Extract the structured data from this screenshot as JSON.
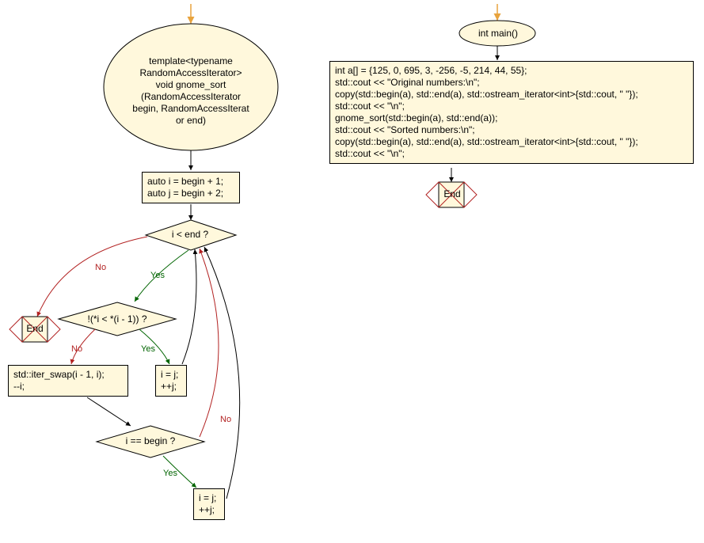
{
  "chart_data": {
    "type": "flowchart",
    "functions": [
      {
        "name": "gnome_sort",
        "signature": "template<typename RandomAccessIterator> void gnome_sort (RandomAccessIterator begin, RandomAccessIterat or end)",
        "nodes": [
          {
            "id": "start1",
            "kind": "start",
            "label": "template<typename RandomAccessIterator> void gnome_sort (RandomAccessIterator begin, RandomAccessIterat or end)"
          },
          {
            "id": "init1",
            "kind": "process",
            "label": "auto i = begin + 1;\nauto j = begin + 2;"
          },
          {
            "id": "cond_outer",
            "kind": "decision",
            "label": "i < end ?"
          },
          {
            "id": "end1",
            "kind": "end",
            "label": "End"
          },
          {
            "id": "cond_inner",
            "kind": "decision",
            "label": "!(*i < *(i - 1)) ?"
          },
          {
            "id": "swap",
            "kind": "process",
            "label": "std::iter_swap(i - 1, i);\n--i;"
          },
          {
            "id": "advance1",
            "kind": "process",
            "label": "i = j;\n++j;"
          },
          {
            "id": "cond_begin",
            "kind": "decision",
            "label": "i == begin ?"
          },
          {
            "id": "advance2",
            "kind": "process",
            "label": "i = j;\n++j;"
          }
        ],
        "edges": [
          {
            "from": "start1",
            "to": "init1"
          },
          {
            "from": "init1",
            "to": "cond_outer"
          },
          {
            "from": "cond_outer",
            "to": "end1",
            "label": "No"
          },
          {
            "from": "cond_outer",
            "to": "cond_inner",
            "label": "Yes"
          },
          {
            "from": "cond_inner",
            "to": "swap",
            "label": "No"
          },
          {
            "from": "cond_inner",
            "to": "advance1",
            "label": "Yes"
          },
          {
            "from": "advance1",
            "to": "cond_outer"
          },
          {
            "from": "swap",
            "to": "cond_begin"
          },
          {
            "from": "cond_begin",
            "to": "cond_outer",
            "label": "No"
          },
          {
            "from": "cond_begin",
            "to": "advance2",
            "label": "Yes"
          },
          {
            "from": "advance2",
            "to": "cond_outer"
          }
        ]
      },
      {
        "name": "main",
        "signature": "int main()",
        "nodes": [
          {
            "id": "start2",
            "kind": "start",
            "label": "int main()"
          },
          {
            "id": "body2",
            "kind": "process",
            "label": "int a[] = {125, 0, 695, 3, -256, -5, 214, 44, 55};\nstd::cout << \"Original numbers:\\n\";\ncopy(std::begin(a), std::end(a), std::ostream_iterator<int>{std::cout, \" \"});\nstd::cout << \"\\n\";\ngnome_sort(std::begin(a), std::end(a));\nstd::cout << \"Sorted numbers:\\n\";\ncopy(std::begin(a), std::end(a), std::ostream_iterator<int>{std::cout, \" \"});\nstd::cout << \"\\n\";"
          },
          {
            "id": "end2",
            "kind": "end",
            "label": "End"
          }
        ],
        "edges": [
          {
            "from": "start2",
            "to": "body2"
          },
          {
            "from": "body2",
            "to": "end2"
          }
        ]
      }
    ]
  },
  "labels": {
    "start1": "template<typename\nRandomAccessIterator>\nvoid gnome_sort\n(RandomAccessIterator\nbegin, RandomAccessIterat\nor end)",
    "init_line1": "auto i = begin + 1;",
    "init_line2": "auto j = begin + 2;",
    "cond_outer": "i < end ?",
    "end1": "End",
    "cond_inner": "!(*i < *(i - 1)) ?",
    "swap_line1": "std::iter_swap(i - 1, i);",
    "swap_line2": "--i;",
    "advance1_line1": "i = j;",
    "advance1_line2": "++j;",
    "cond_begin": "i == begin ?",
    "advance2_line1": "i = j;",
    "advance2_line2": "++j;",
    "start2": "int main()",
    "body2_l1": "int a[] = {125, 0, 695, 3, -256, -5, 214, 44, 55};",
    "body2_l2": "std::cout << \"Original numbers:\\n\";",
    "body2_l3": "copy(std::begin(a), std::end(a), std::ostream_iterator<int>{std::cout, \" \"});",
    "body2_l4": "std::cout << \"\\n\";",
    "body2_l5": "gnome_sort(std::begin(a), std::end(a));",
    "body2_l6": "std::cout << \"Sorted numbers:\\n\";",
    "body2_l7": "copy(std::begin(a), std::end(a), std::ostream_iterator<int>{std::cout, \" \"});",
    "body2_l8": "std::cout << \"\\n\";",
    "end2": "End",
    "no": "No",
    "yes": "Yes"
  },
  "colors": {
    "fill": "#fff8dc",
    "stroke": "#000000",
    "end_stroke": "#b22222",
    "arrow_orange": "#e8a33d",
    "edge_no": "#b22222",
    "edge_yes": "#006400"
  }
}
